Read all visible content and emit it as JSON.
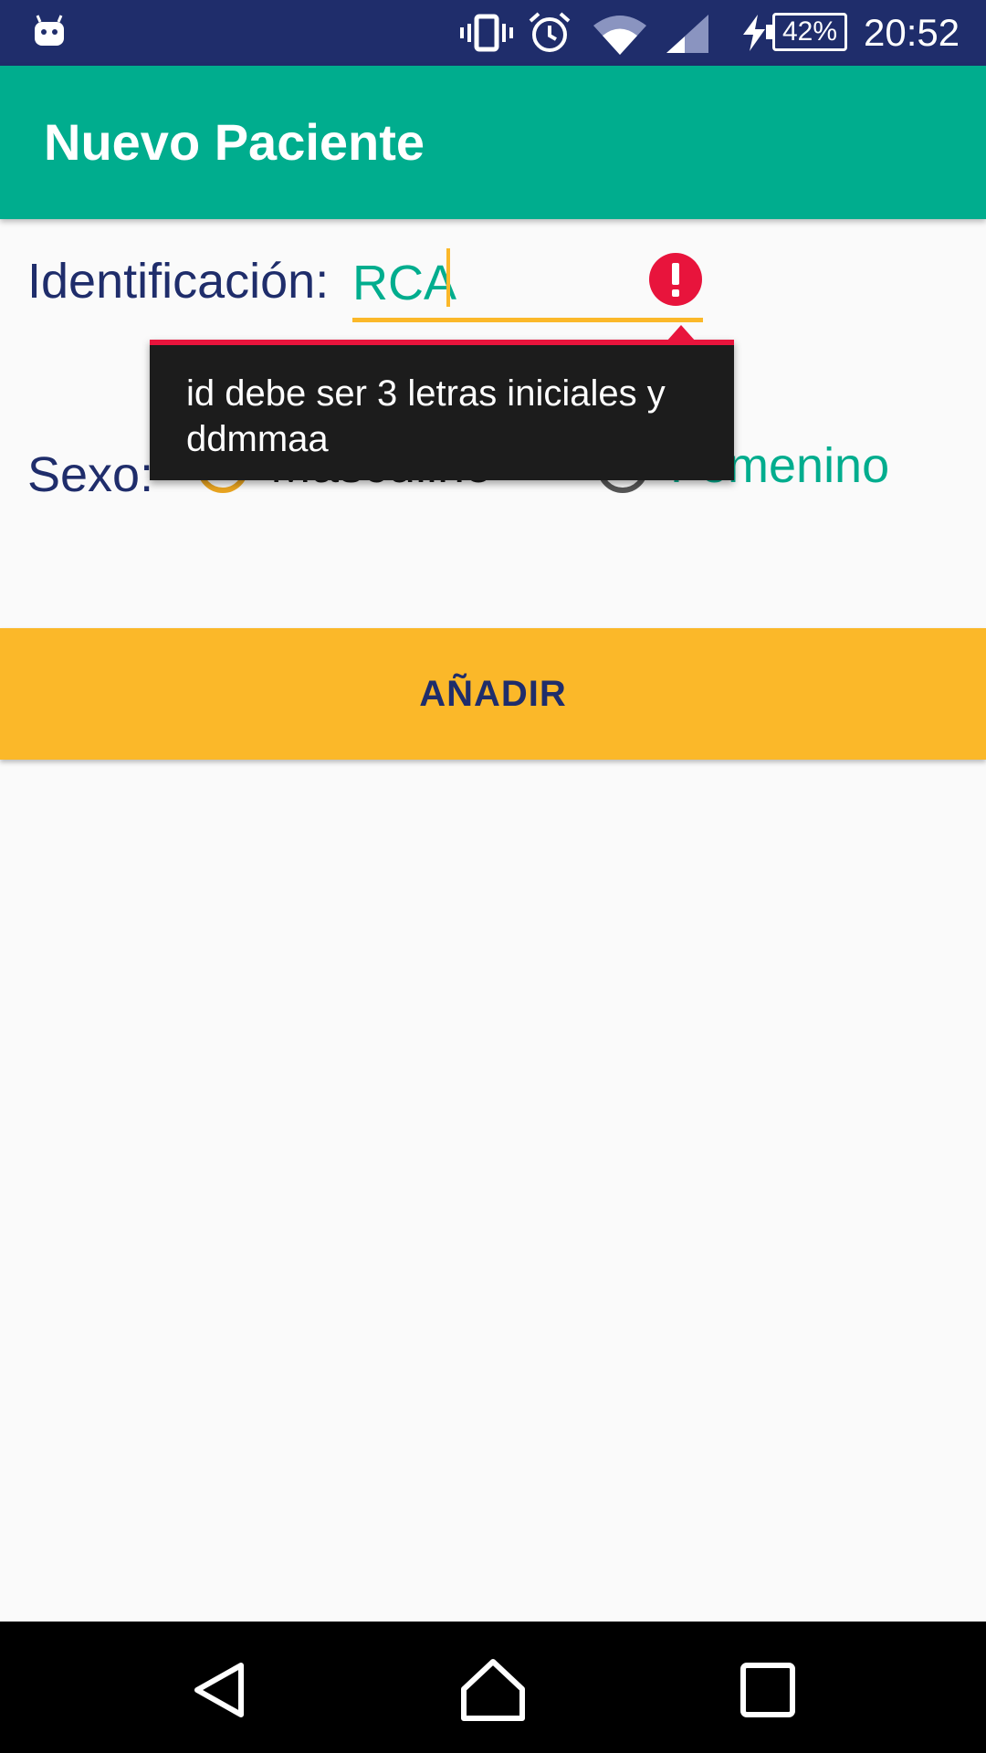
{
  "status_bar": {
    "time": "20:52",
    "battery_percent": "42%",
    "icons": [
      "android-icon",
      "vibrate-icon",
      "alarm-icon",
      "wifi-icon",
      "signal-icon",
      "charging-icon",
      "battery-icon"
    ]
  },
  "app_bar": {
    "title": "Nuevo Paciente"
  },
  "form": {
    "id_label": "Identificación:",
    "id_value": "RCA",
    "error_message": "id debe ser 3 letras iniciales y ddmmaa",
    "sex_label": "Sexo:",
    "sex_options": [
      {
        "label": "Masculino",
        "selected": true
      },
      {
        "label": "Femenino",
        "selected": false
      }
    ],
    "add_button_label": "AÑADIR"
  },
  "colors": {
    "primary_dark": "#1f2d6b",
    "primary": "#00ad8e",
    "accent": "#fbb829",
    "error": "#e8143c"
  },
  "nav_bar": {
    "icons": [
      "back-icon",
      "home-icon",
      "recents-icon"
    ]
  }
}
